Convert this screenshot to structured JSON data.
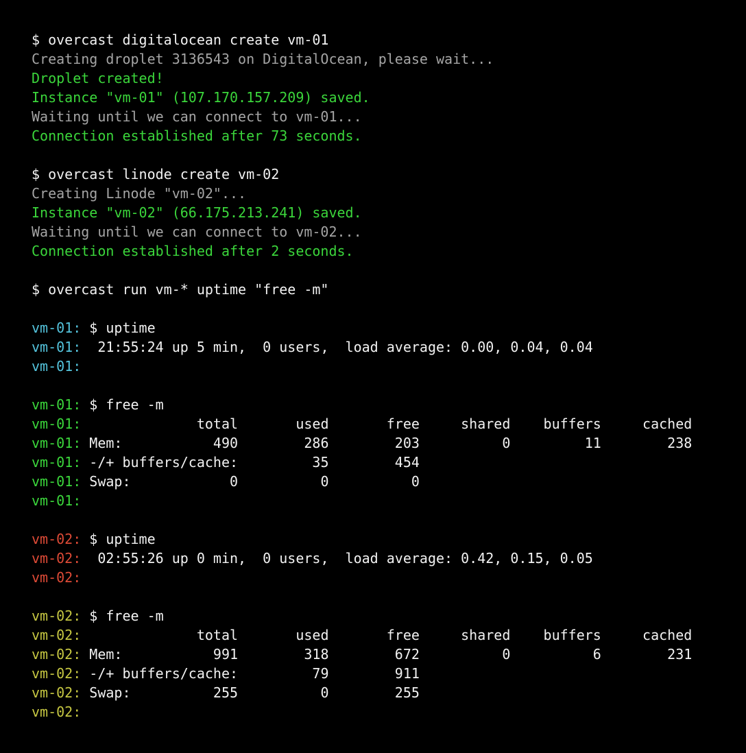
{
  "colors": {
    "background": "#000000",
    "text": "#f2f2f2",
    "gray": "#a5a5a5",
    "green": "#3bd63b",
    "vm01_cyan": "#54c3dc",
    "vm01_green": "#3bd63b",
    "vm02_red": "#dd4a36",
    "vm02_yellow": "#c6c742"
  },
  "lines": [
    "$ overcast digitalocean create vm-01",
    "Creating droplet 3136543 on DigitalOcean, please wait...",
    "Droplet created!",
    "Instance \"vm-01\" (107.170.157.209) saved.",
    "Waiting until we can connect to vm-01...",
    "Connection established after 73 seconds.",
    "",
    "$ overcast linode create vm-02",
    "Creating Linode \"vm-02\"...",
    "Instance \"vm-02\" (66.175.213.241) saved.",
    "Waiting until we can connect to vm-02...",
    "Connection established after 2 seconds.",
    "",
    "$ overcast run vm-* uptime \"free -m\"",
    "",
    {
      "host": "vm-01:",
      "text": " $ uptime"
    },
    {
      "host": "vm-01:",
      "text": "  21:55:24 up 5 min,  0 users,  load average: 0.00, 0.04, 0.04"
    },
    {
      "host": "vm-01:",
      "text": ""
    },
    "",
    {
      "host": "vm-01:",
      "text": " $ free -m"
    },
    {
      "host": "vm-01:",
      "text": "              total       used       free     shared    buffers     cached"
    },
    {
      "host": "vm-01:",
      "text": " Mem:           490        286        203          0         11        238"
    },
    {
      "host": "vm-01:",
      "text": " -/+ buffers/cache:         35        454"
    },
    {
      "host": "vm-01:",
      "text": " Swap:            0          0          0"
    },
    {
      "host": "vm-01:",
      "text": ""
    },
    "",
    {
      "host": "vm-02:",
      "text": " $ uptime"
    },
    {
      "host": "vm-02:",
      "text": "  02:55:26 up 0 min,  0 users,  load average: 0.42, 0.15, 0.05"
    },
    {
      "host": "vm-02:",
      "text": ""
    },
    "",
    {
      "host": "vm-02:",
      "text": " $ free -m"
    },
    {
      "host": "vm-02:",
      "text": "              total       used       free     shared    buffers     cached"
    },
    {
      "host": "vm-02:",
      "text": " Mem:           991        318        672          0          6        231"
    },
    {
      "host": "vm-02:",
      "text": " -/+ buffers/cache:         79        911"
    },
    {
      "host": "vm-02:",
      "text": " Swap:          255          0        255"
    },
    {
      "host": "vm-02:",
      "text": ""
    }
  ]
}
